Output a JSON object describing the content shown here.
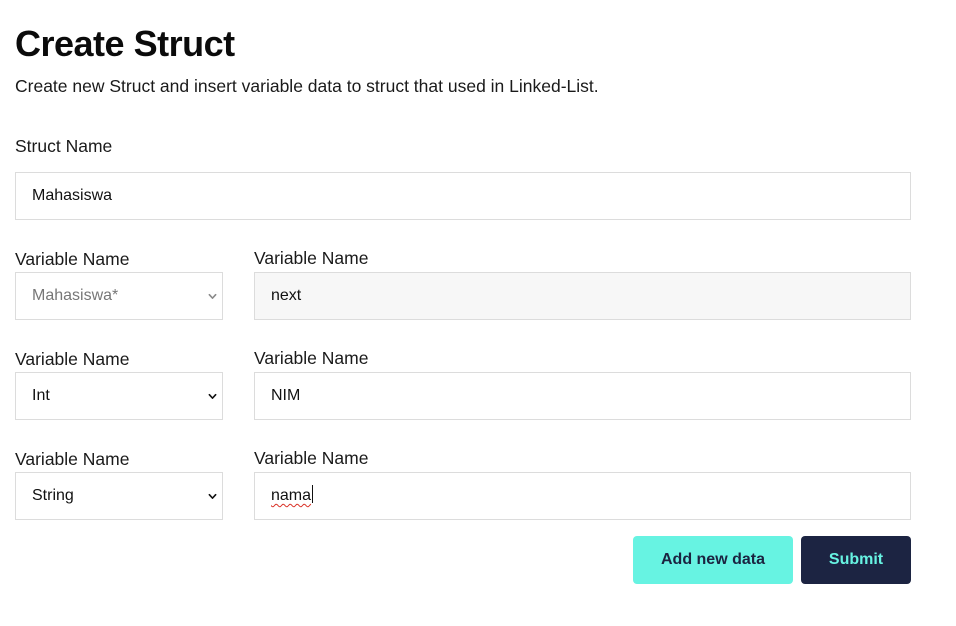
{
  "header": {
    "title": "Create Struct",
    "subtitle": "Create new Struct and insert variable data to struct that used in Linked-List."
  },
  "struct": {
    "label": "Struct Name",
    "value": "Mahasiswa"
  },
  "rows": [
    {
      "type_label": "Variable Name",
      "type_value": "Mahasiswa*",
      "type_disabled": true,
      "name_label": "Variable Name",
      "name_value": "next",
      "name_readonly": true
    },
    {
      "type_label": "Variable Name",
      "type_value": "Int",
      "type_disabled": false,
      "name_label": "Variable Name",
      "name_value": "NIM",
      "name_readonly": false
    },
    {
      "type_label": "Variable Name",
      "type_value": "String",
      "type_disabled": false,
      "name_label": "Variable Name",
      "name_value": "nama",
      "name_readonly": false
    }
  ],
  "actions": {
    "add_label": "Add new data",
    "submit_label": "Submit"
  },
  "colors": {
    "accent": "#67f3e2",
    "primary_dark": "#1c2442",
    "input_border": "#dcdcdc",
    "readonly_bg": "#f7f7f7",
    "spellcheck_underline": "#d93025"
  },
  "icons": {
    "select_arrow": "chevron-down-icon",
    "text_caret": "text-cursor"
  }
}
